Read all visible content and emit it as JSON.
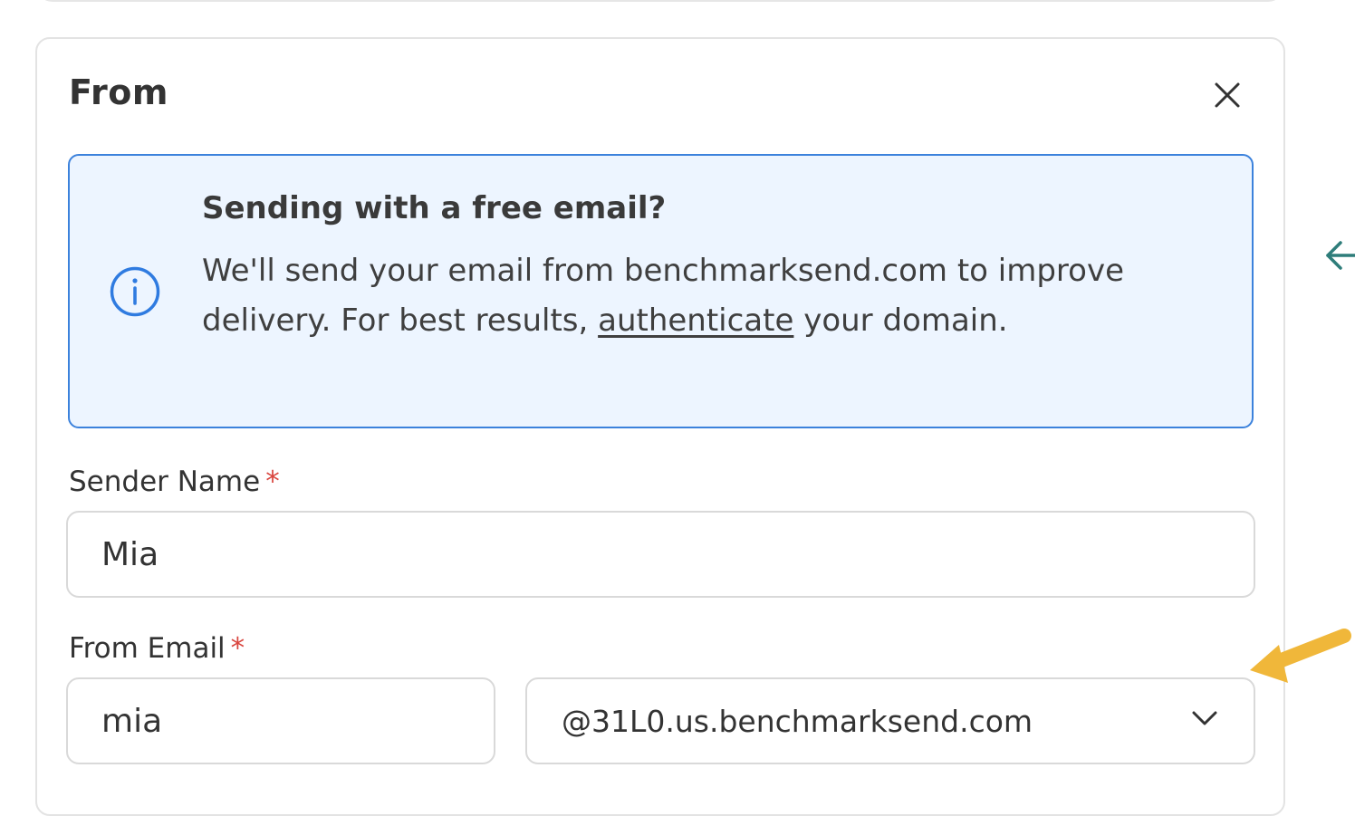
{
  "panel": {
    "title": "From",
    "close_icon": "close-icon"
  },
  "notice": {
    "icon": "info-icon",
    "title": "Sending with a free email?",
    "text_before_link": "We'll send your email from benchmarksend.com to improve delivery. For best results, ",
    "link_text": "authenticate",
    "text_after_link": " your domain.",
    "border_color": "#3c82dc",
    "background_color": "#edf5ff"
  },
  "sender_name": {
    "label": "Sender Name",
    "required_mark": "*",
    "value": "Mia"
  },
  "from_email": {
    "label": "From Email",
    "required_mark": "*",
    "local_part_value": "mia",
    "domain_selected": "@31L0.us.benchmarksend.com",
    "dropdown_icon": "chevron-down-icon"
  },
  "side_control": {
    "icon": "arrow-left-icon",
    "color": "#2e7d7a"
  },
  "annotation": {
    "icon": "annotation-arrow-icon",
    "color": "#f0b73a"
  }
}
